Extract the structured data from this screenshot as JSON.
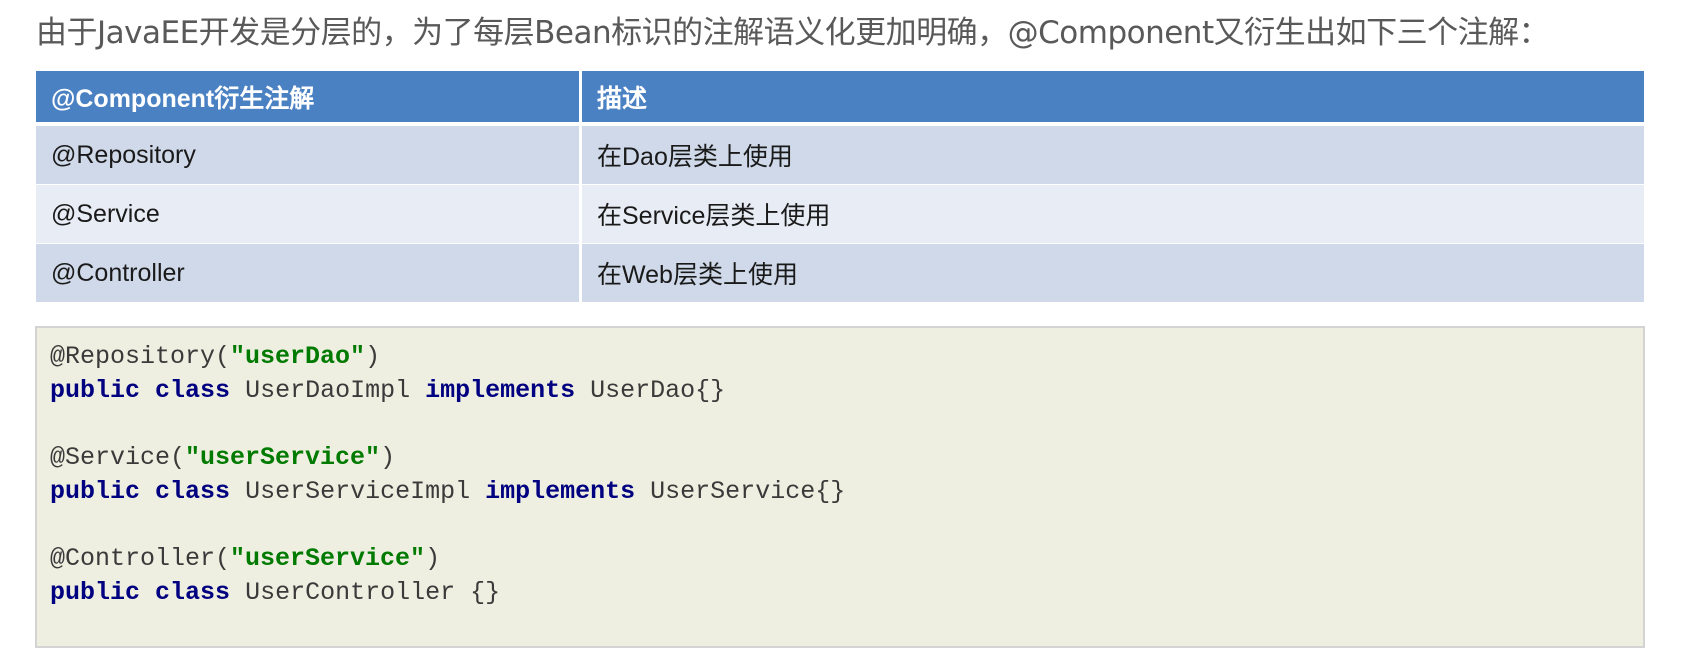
{
  "intro_text": "由于JavaEE开发是分层的，为了每层Bean标识的注解语义化更加明确，@Component又衍生出如下三个注解：",
  "table": {
    "headers": [
      "@Component衍生注解",
      "描述"
    ],
    "rows": [
      [
        "@Repository",
        "在Dao层类上使用"
      ],
      [
        "@Service",
        "在Service层类上使用"
      ],
      [
        "@Controller",
        "在Web层类上使用"
      ]
    ]
  },
  "code": {
    "block1": {
      "annotation": "@Repository(",
      "name": "\"userDao\"",
      "close": ")",
      "kw_public": "public",
      "kw_class": "class",
      "class_name": "UserDaoImpl",
      "kw_implements": "implements",
      "iface": "UserDao{}"
    },
    "block2": {
      "annotation": "@Service(",
      "name": "\"userService\"",
      "close": ")",
      "kw_public": "public",
      "kw_class": "class",
      "class_name": "UserServiceImpl",
      "kw_implements": "implements",
      "iface": "UserService{}"
    },
    "block3": {
      "annotation": "@Controller(",
      "name": "\"userService\"",
      "close": ")",
      "kw_public": "public",
      "kw_class": "class",
      "class_name": "UserController {}"
    }
  },
  "colors": {
    "table_header_bg": "#4a81c3",
    "table_row_odd": "#cfd9e9",
    "table_row_even": "#e8edf5",
    "code_bg": "#eeefe0",
    "keyword": "#000080",
    "string": "#007a00"
  }
}
